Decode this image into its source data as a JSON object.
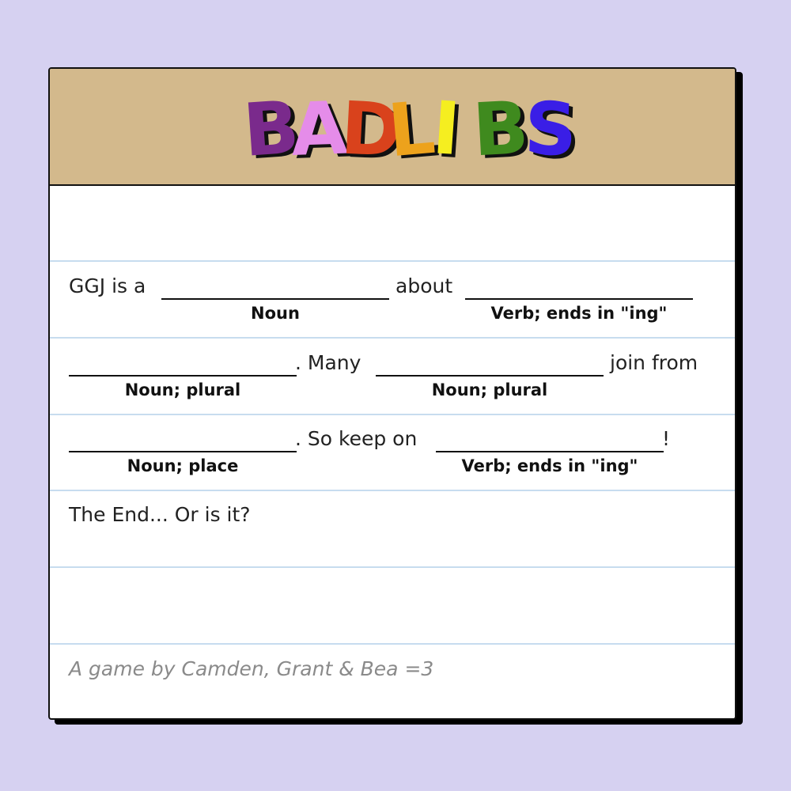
{
  "title": {
    "text": "BADLIBS",
    "letters": [
      {
        "char": "B",
        "color": "#7a2a8c"
      },
      {
        "char": "A",
        "color": "#e58ce9"
      },
      {
        "char": "D",
        "color": "#d9421c"
      },
      {
        "char": "L",
        "color": "#eda21c"
      },
      {
        "char": "I",
        "color": "#f5ee20"
      },
      {
        "char": "B",
        "color": "#3f8a1e"
      },
      {
        "char": "S",
        "color": "#3a1ee6"
      }
    ]
  },
  "story": {
    "line1": {
      "prefix": "GGJ is a",
      "middle": "about",
      "hint1": "Noun",
      "hint2": "Verb; ends in \"ing\""
    },
    "line2": {
      "middle": ". Many",
      "suffix": "join from",
      "hint1": "Noun; plural",
      "hint2": "Noun; plural"
    },
    "line3": {
      "middle": ". So keep on",
      "suffix": "!",
      "hint1": "Noun; place",
      "hint2": "Verb; ends in \"ing\""
    },
    "ending": "The End... Or is it?"
  },
  "footer": {
    "credit": "A game by Camden, Grant & Bea =3"
  },
  "colors": {
    "background": "#d6d1f1",
    "header": "#d3b98c",
    "rule": "#c7dcef"
  }
}
